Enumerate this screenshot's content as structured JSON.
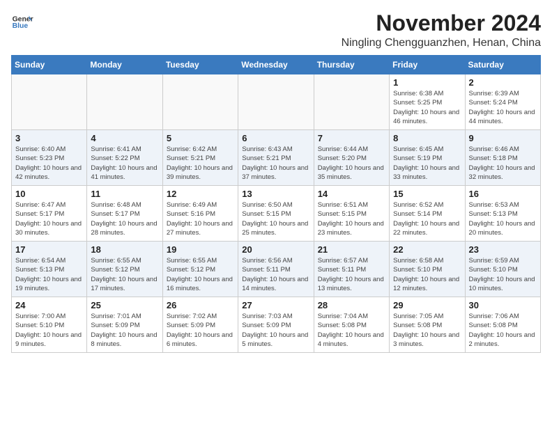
{
  "logo": {
    "general": "General",
    "blue": "Blue"
  },
  "header": {
    "month": "November 2024",
    "location": "Ningling Chengguanzhen, Henan, China"
  },
  "weekdays": [
    "Sunday",
    "Monday",
    "Tuesday",
    "Wednesday",
    "Thursday",
    "Friday",
    "Saturday"
  ],
  "weeks": [
    [
      {
        "day": "",
        "info": ""
      },
      {
        "day": "",
        "info": ""
      },
      {
        "day": "",
        "info": ""
      },
      {
        "day": "",
        "info": ""
      },
      {
        "day": "",
        "info": ""
      },
      {
        "day": "1",
        "info": "Sunrise: 6:38 AM\nSunset: 5:25 PM\nDaylight: 10 hours and 46 minutes."
      },
      {
        "day": "2",
        "info": "Sunrise: 6:39 AM\nSunset: 5:24 PM\nDaylight: 10 hours and 44 minutes."
      }
    ],
    [
      {
        "day": "3",
        "info": "Sunrise: 6:40 AM\nSunset: 5:23 PM\nDaylight: 10 hours and 42 minutes."
      },
      {
        "day": "4",
        "info": "Sunrise: 6:41 AM\nSunset: 5:22 PM\nDaylight: 10 hours and 41 minutes."
      },
      {
        "day": "5",
        "info": "Sunrise: 6:42 AM\nSunset: 5:21 PM\nDaylight: 10 hours and 39 minutes."
      },
      {
        "day": "6",
        "info": "Sunrise: 6:43 AM\nSunset: 5:21 PM\nDaylight: 10 hours and 37 minutes."
      },
      {
        "day": "7",
        "info": "Sunrise: 6:44 AM\nSunset: 5:20 PM\nDaylight: 10 hours and 35 minutes."
      },
      {
        "day": "8",
        "info": "Sunrise: 6:45 AM\nSunset: 5:19 PM\nDaylight: 10 hours and 33 minutes."
      },
      {
        "day": "9",
        "info": "Sunrise: 6:46 AM\nSunset: 5:18 PM\nDaylight: 10 hours and 32 minutes."
      }
    ],
    [
      {
        "day": "10",
        "info": "Sunrise: 6:47 AM\nSunset: 5:17 PM\nDaylight: 10 hours and 30 minutes."
      },
      {
        "day": "11",
        "info": "Sunrise: 6:48 AM\nSunset: 5:17 PM\nDaylight: 10 hours and 28 minutes."
      },
      {
        "day": "12",
        "info": "Sunrise: 6:49 AM\nSunset: 5:16 PM\nDaylight: 10 hours and 27 minutes."
      },
      {
        "day": "13",
        "info": "Sunrise: 6:50 AM\nSunset: 5:15 PM\nDaylight: 10 hours and 25 minutes."
      },
      {
        "day": "14",
        "info": "Sunrise: 6:51 AM\nSunset: 5:15 PM\nDaylight: 10 hours and 23 minutes."
      },
      {
        "day": "15",
        "info": "Sunrise: 6:52 AM\nSunset: 5:14 PM\nDaylight: 10 hours and 22 minutes."
      },
      {
        "day": "16",
        "info": "Sunrise: 6:53 AM\nSunset: 5:13 PM\nDaylight: 10 hours and 20 minutes."
      }
    ],
    [
      {
        "day": "17",
        "info": "Sunrise: 6:54 AM\nSunset: 5:13 PM\nDaylight: 10 hours and 19 minutes."
      },
      {
        "day": "18",
        "info": "Sunrise: 6:55 AM\nSunset: 5:12 PM\nDaylight: 10 hours and 17 minutes."
      },
      {
        "day": "19",
        "info": "Sunrise: 6:55 AM\nSunset: 5:12 PM\nDaylight: 10 hours and 16 minutes."
      },
      {
        "day": "20",
        "info": "Sunrise: 6:56 AM\nSunset: 5:11 PM\nDaylight: 10 hours and 14 minutes."
      },
      {
        "day": "21",
        "info": "Sunrise: 6:57 AM\nSunset: 5:11 PM\nDaylight: 10 hours and 13 minutes."
      },
      {
        "day": "22",
        "info": "Sunrise: 6:58 AM\nSunset: 5:10 PM\nDaylight: 10 hours and 12 minutes."
      },
      {
        "day": "23",
        "info": "Sunrise: 6:59 AM\nSunset: 5:10 PM\nDaylight: 10 hours and 10 minutes."
      }
    ],
    [
      {
        "day": "24",
        "info": "Sunrise: 7:00 AM\nSunset: 5:10 PM\nDaylight: 10 hours and 9 minutes."
      },
      {
        "day": "25",
        "info": "Sunrise: 7:01 AM\nSunset: 5:09 PM\nDaylight: 10 hours and 8 minutes."
      },
      {
        "day": "26",
        "info": "Sunrise: 7:02 AM\nSunset: 5:09 PM\nDaylight: 10 hours and 6 minutes."
      },
      {
        "day": "27",
        "info": "Sunrise: 7:03 AM\nSunset: 5:09 PM\nDaylight: 10 hours and 5 minutes."
      },
      {
        "day": "28",
        "info": "Sunrise: 7:04 AM\nSunset: 5:08 PM\nDaylight: 10 hours and 4 minutes."
      },
      {
        "day": "29",
        "info": "Sunrise: 7:05 AM\nSunset: 5:08 PM\nDaylight: 10 hours and 3 minutes."
      },
      {
        "day": "30",
        "info": "Sunrise: 7:06 AM\nSunset: 5:08 PM\nDaylight: 10 hours and 2 minutes."
      }
    ]
  ]
}
